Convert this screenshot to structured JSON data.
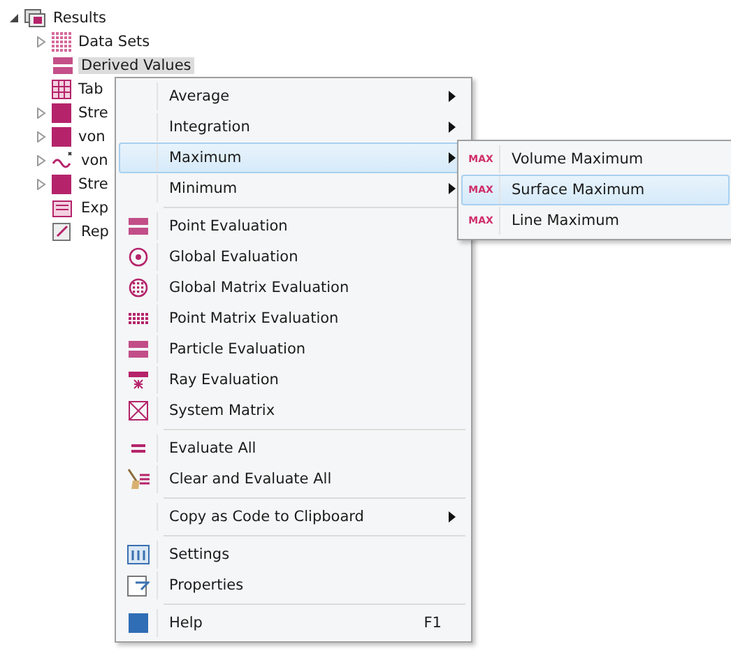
{
  "tree": {
    "label": "Results",
    "expanded": true,
    "children": [
      {
        "label": "Data Sets",
        "expandable": true,
        "selected": false
      },
      {
        "label": "Derived Values",
        "expandable": false,
        "selected": true
      },
      {
        "label": "Tab",
        "expandable": false,
        "selected": false
      },
      {
        "label": "Stre",
        "expandable": true,
        "selected": false
      },
      {
        "label": "von",
        "expandable": true,
        "selected": false
      },
      {
        "label": "von",
        "expandable": true,
        "selected": false
      },
      {
        "label": "Stre",
        "expandable": true,
        "selected": false
      },
      {
        "label": "Exp",
        "expandable": false,
        "selected": false
      },
      {
        "label": "Rep",
        "expandable": false,
        "selected": false
      }
    ]
  },
  "context_menu": {
    "items": [
      {
        "kind": "item",
        "label": "Average",
        "submenu": true,
        "selected": false
      },
      {
        "kind": "item",
        "label": "Integration",
        "submenu": true,
        "selected": false
      },
      {
        "kind": "item",
        "label": "Maximum",
        "submenu": true,
        "selected": true
      },
      {
        "kind": "item",
        "label": "Minimum",
        "submenu": true,
        "selected": false
      },
      {
        "kind": "separator"
      },
      {
        "kind": "item",
        "label": "Point Evaluation",
        "submenu": false,
        "selected": false
      },
      {
        "kind": "item",
        "label": "Global Evaluation",
        "submenu": false,
        "selected": false
      },
      {
        "kind": "item",
        "label": "Global Matrix Evaluation",
        "submenu": false,
        "selected": false
      },
      {
        "kind": "item",
        "label": "Point Matrix Evaluation",
        "submenu": false,
        "selected": false
      },
      {
        "kind": "item",
        "label": "Particle Evaluation",
        "submenu": false,
        "selected": false
      },
      {
        "kind": "item",
        "label": "Ray Evaluation",
        "submenu": false,
        "selected": false
      },
      {
        "kind": "item",
        "label": "System Matrix",
        "submenu": false,
        "selected": false
      },
      {
        "kind": "separator"
      },
      {
        "kind": "item",
        "label": "Evaluate All",
        "submenu": false,
        "selected": false
      },
      {
        "kind": "item",
        "label": "Clear and Evaluate All",
        "submenu": false,
        "selected": false
      },
      {
        "kind": "separator"
      },
      {
        "kind": "item",
        "label": "Copy as Code to Clipboard",
        "submenu": true,
        "selected": false
      },
      {
        "kind": "separator"
      },
      {
        "kind": "item",
        "label": "Settings",
        "submenu": false,
        "selected": false
      },
      {
        "kind": "item",
        "label": "Properties",
        "submenu": false,
        "selected": false
      },
      {
        "kind": "separator"
      },
      {
        "kind": "item",
        "label": "Help",
        "submenu": false,
        "selected": false,
        "shortcut": "F1"
      }
    ]
  },
  "submenu": {
    "items": [
      {
        "badge": "MAX",
        "label": "Volume Maximum",
        "selected": false
      },
      {
        "badge": "MAX",
        "label": "Surface Maximum",
        "selected": true
      },
      {
        "badge": "MAX",
        "label": "Line Maximum",
        "selected": false
      }
    ]
  }
}
